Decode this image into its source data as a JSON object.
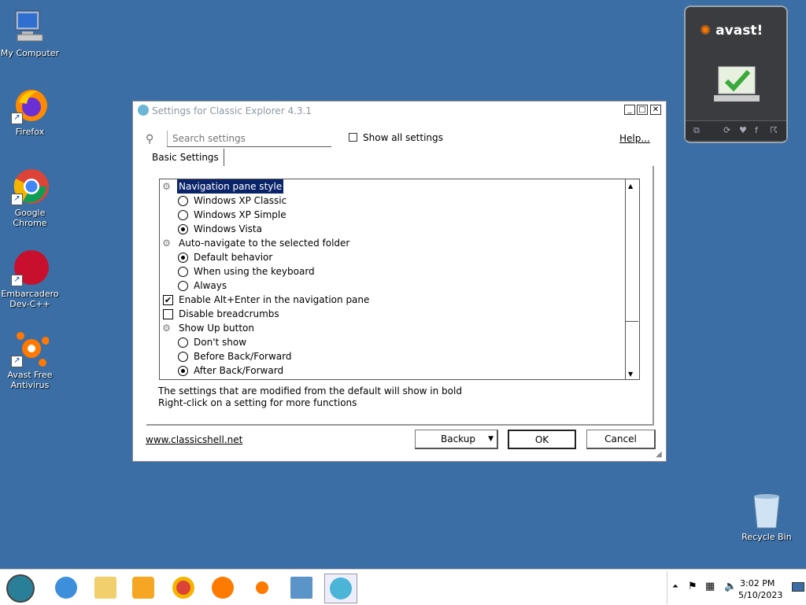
{
  "desktop": {
    "icons": [
      {
        "label": "My Computer"
      },
      {
        "label": "Firefox"
      },
      {
        "label": "Google Chrome"
      },
      {
        "label": "Embarcadero Dev-C++"
      },
      {
        "label": "Avast Free Antivirus"
      },
      {
        "label": "Recycle Bin"
      }
    ]
  },
  "avast": {
    "logo": "avast!"
  },
  "dialog": {
    "title": "Settings for Classic Explorer 4.3.1",
    "search_placeholder": "Search settings",
    "show_all_label": "Show all settings",
    "help_link": "Help...",
    "tab_basic": "Basic Settings",
    "tree": [
      {
        "kind": "group",
        "label": "Navigation pane style",
        "selected": true
      },
      {
        "kind": "radio",
        "label": "Windows XP Classic",
        "checked": false
      },
      {
        "kind": "radio",
        "label": "Windows XP Simple",
        "checked": false
      },
      {
        "kind": "radio",
        "label": "Windows Vista",
        "checked": true
      },
      {
        "kind": "group",
        "label": "Auto-navigate to the selected folder"
      },
      {
        "kind": "radio",
        "label": "Default behavior",
        "checked": true
      },
      {
        "kind": "radio",
        "label": "When using the keyboard",
        "checked": false
      },
      {
        "kind": "radio",
        "label": "Always",
        "checked": false
      },
      {
        "kind": "check",
        "label": "Enable Alt+Enter in the navigation pane",
        "checked": true
      },
      {
        "kind": "check",
        "label": "Disable breadcrumbs",
        "checked": false
      },
      {
        "kind": "group",
        "label": "Show Up button"
      },
      {
        "kind": "radio",
        "label": "Don't show",
        "checked": false
      },
      {
        "kind": "radio",
        "label": "Before Back/Forward",
        "checked": false
      },
      {
        "kind": "radio",
        "label": "After Back/Forward",
        "checked": true
      }
    ],
    "info_line1": "The settings that are modified from the default will show in bold",
    "info_line2": "Right-click on a setting for more functions",
    "website_link": "www.classicshell.net",
    "backup_label": "Backup",
    "ok_label": "OK",
    "cancel_label": "Cancel"
  },
  "taskbar": {
    "clock_time": "3:02 PM",
    "clock_date": "5/10/2023"
  }
}
